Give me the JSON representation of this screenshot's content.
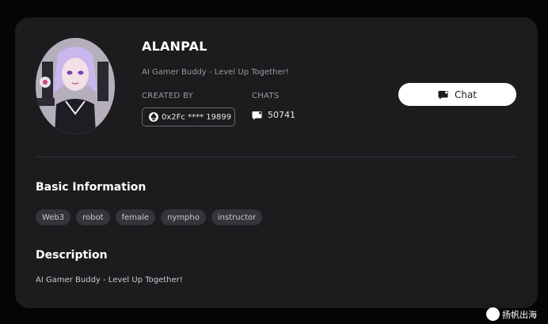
{
  "profile": {
    "name": "ALANPAL",
    "tagline": "AI Gamer Buddy - Level Up Together!",
    "created_by_label": "CREATED BY",
    "creator": "0x2Fc **** 19899",
    "chats_label": "CHATS",
    "chats_count": "50741"
  },
  "actions": {
    "chat_label": "Chat"
  },
  "basic_info": {
    "title": "Basic Information",
    "tags": [
      "Web3",
      "robot",
      "female",
      "nympho",
      "instructor"
    ]
  },
  "description": {
    "title": "Description",
    "text": "AI Gamer Buddy - Level Up Together!"
  },
  "watermark": {
    "text": "扬帆出海"
  },
  "colors": {
    "background": "#050505",
    "card": "#1c1c1f",
    "tag_bg": "#34343a",
    "muted_text": "#9a9aa0",
    "button_bg": "#ffffff"
  },
  "icons": {
    "creator_chain": "ethereum-icon",
    "chats": "chat-bubble-icon",
    "chat_button": "chat-bubble-icon"
  }
}
